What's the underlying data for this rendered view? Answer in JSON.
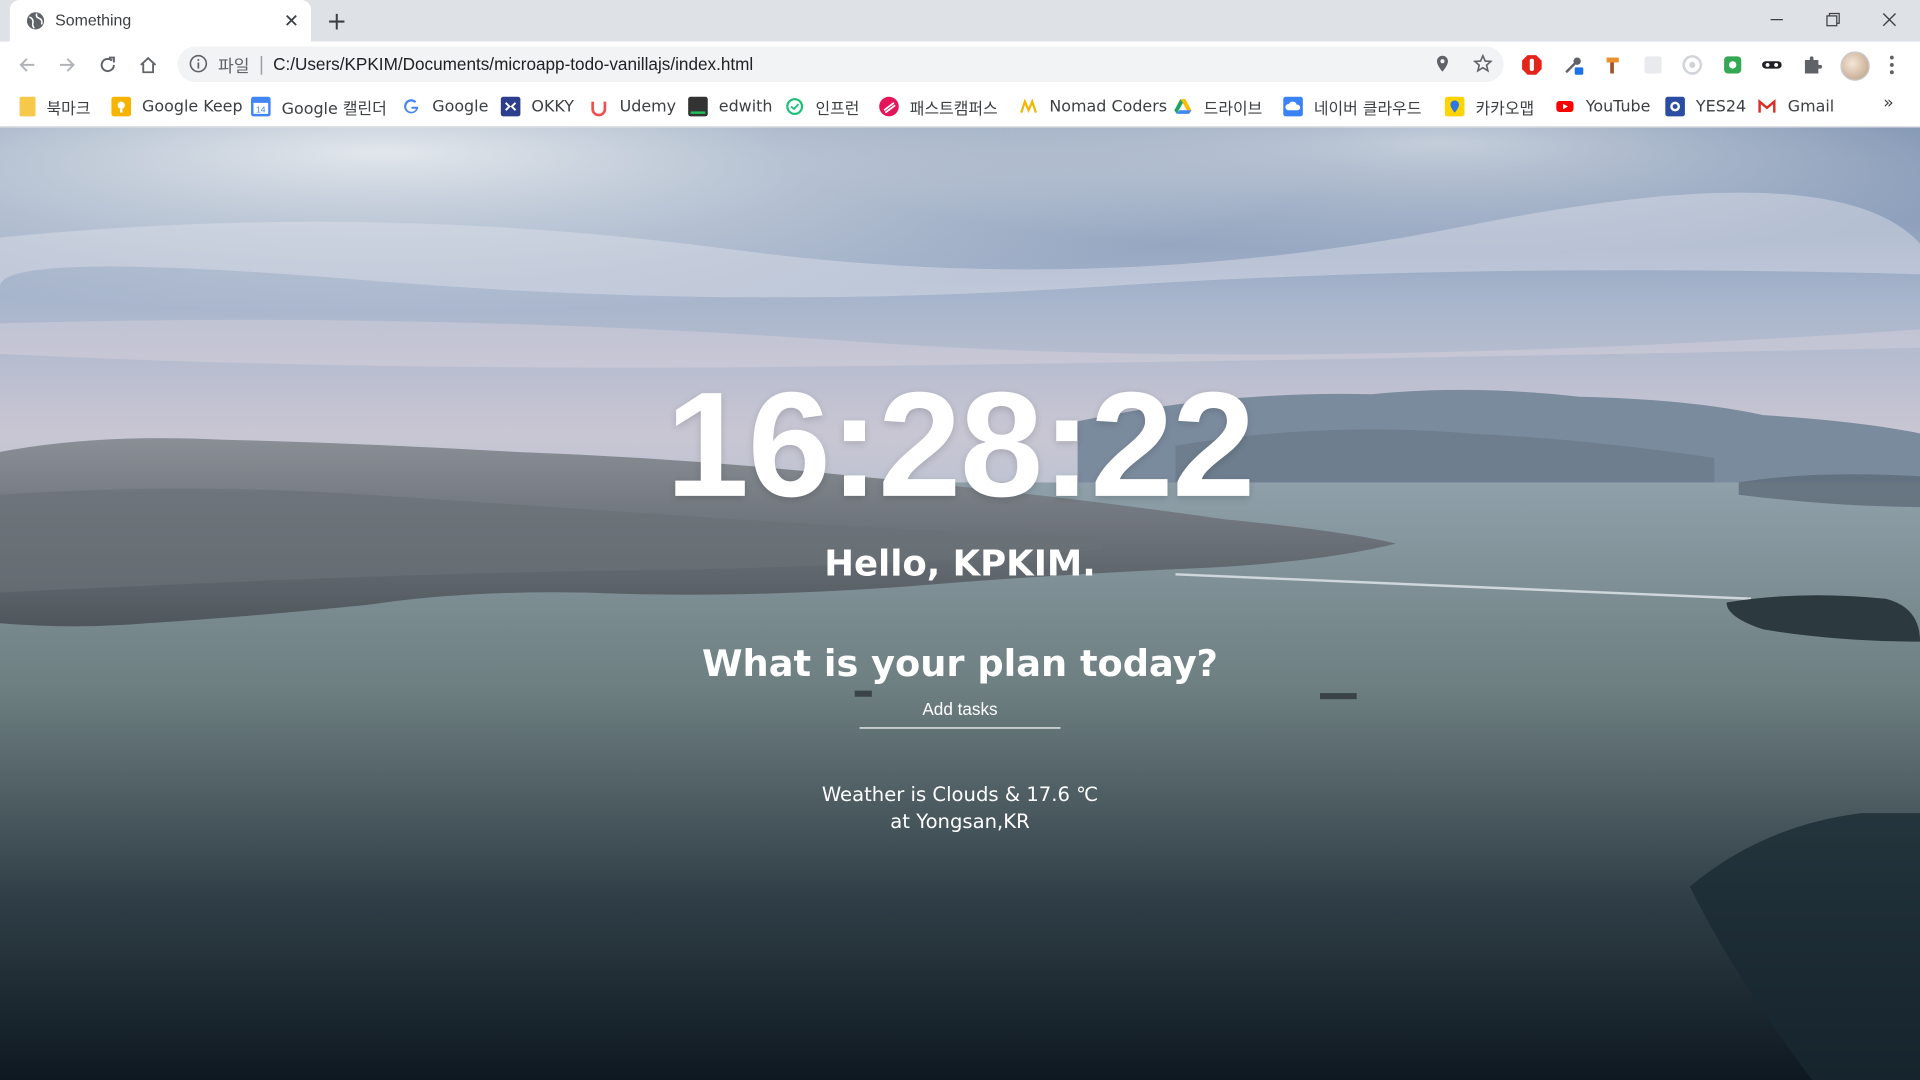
{
  "tab": {
    "title": "Something",
    "close_glyph": "✕",
    "new_tab_glyph": "+"
  },
  "address_bar": {
    "scheme_label": "파일",
    "separator": "|",
    "url": "C:/Users/KPKIM/Documents/microapp-todo-vanillajs/index.html"
  },
  "bookmarks": {
    "items": [
      {
        "label": "북마크",
        "icon": "folder-icon",
        "color": "#f6c94a"
      },
      {
        "label": "Google Keep",
        "icon": "google-keep-icon",
        "color": "#f6b400"
      },
      {
        "label": "Google 캘린더",
        "icon": "google-calendar-icon",
        "color": "#4285f4"
      },
      {
        "label": "Google",
        "icon": "google-icon",
        "color": "#4285f4"
      },
      {
        "label": "OKKY",
        "icon": "okky-icon",
        "color": "#2d3e8c"
      },
      {
        "label": "Udemy",
        "icon": "udemy-icon",
        "color": "#ec5252"
      },
      {
        "label": "edwith",
        "icon": "edwith-icon",
        "color": "#333333"
      },
      {
        "label": "인프런",
        "icon": "inflearn-icon",
        "color": "#1dc078"
      },
      {
        "label": "패스트캠퍼스",
        "icon": "fastcampus-icon",
        "color": "#e5155a"
      },
      {
        "label": "Nomad Coders",
        "icon": "nomad-coders-icon",
        "color": "#f3b600"
      },
      {
        "label": "드라이브",
        "icon": "google-drive-icon",
        "color": "#1fa463"
      },
      {
        "label": "네이버 클라우드",
        "icon": "naver-cloud-icon",
        "color": "#3a82f7"
      },
      {
        "label": "카카오맵",
        "icon": "kakaomap-icon",
        "color": "#ffd400"
      },
      {
        "label": "YouTube",
        "icon": "youtube-icon",
        "color": "#ff0000"
      },
      {
        "label": "YES24",
        "icon": "yes24-icon",
        "color": "#2b4ca3"
      },
      {
        "label": "Gmail",
        "icon": "gmail-icon",
        "color": "#d93025"
      }
    ],
    "more_glyph": "»"
  },
  "page": {
    "clock": "16:28:22",
    "greeting": "Hello, KPKIM.",
    "plan_title": "What is your plan today?",
    "todo_placeholder": "Add tasks",
    "weather_line1": "Weather is Clouds & 17.6 ℃",
    "weather_line2": "at Yongsan,KR"
  },
  "colors": {
    "tabstrip_bg": "#dee1e6",
    "toolbar_bg": "#ffffff",
    "omnibox_bg": "#f1f3f4",
    "page_text": "#ffffff"
  }
}
